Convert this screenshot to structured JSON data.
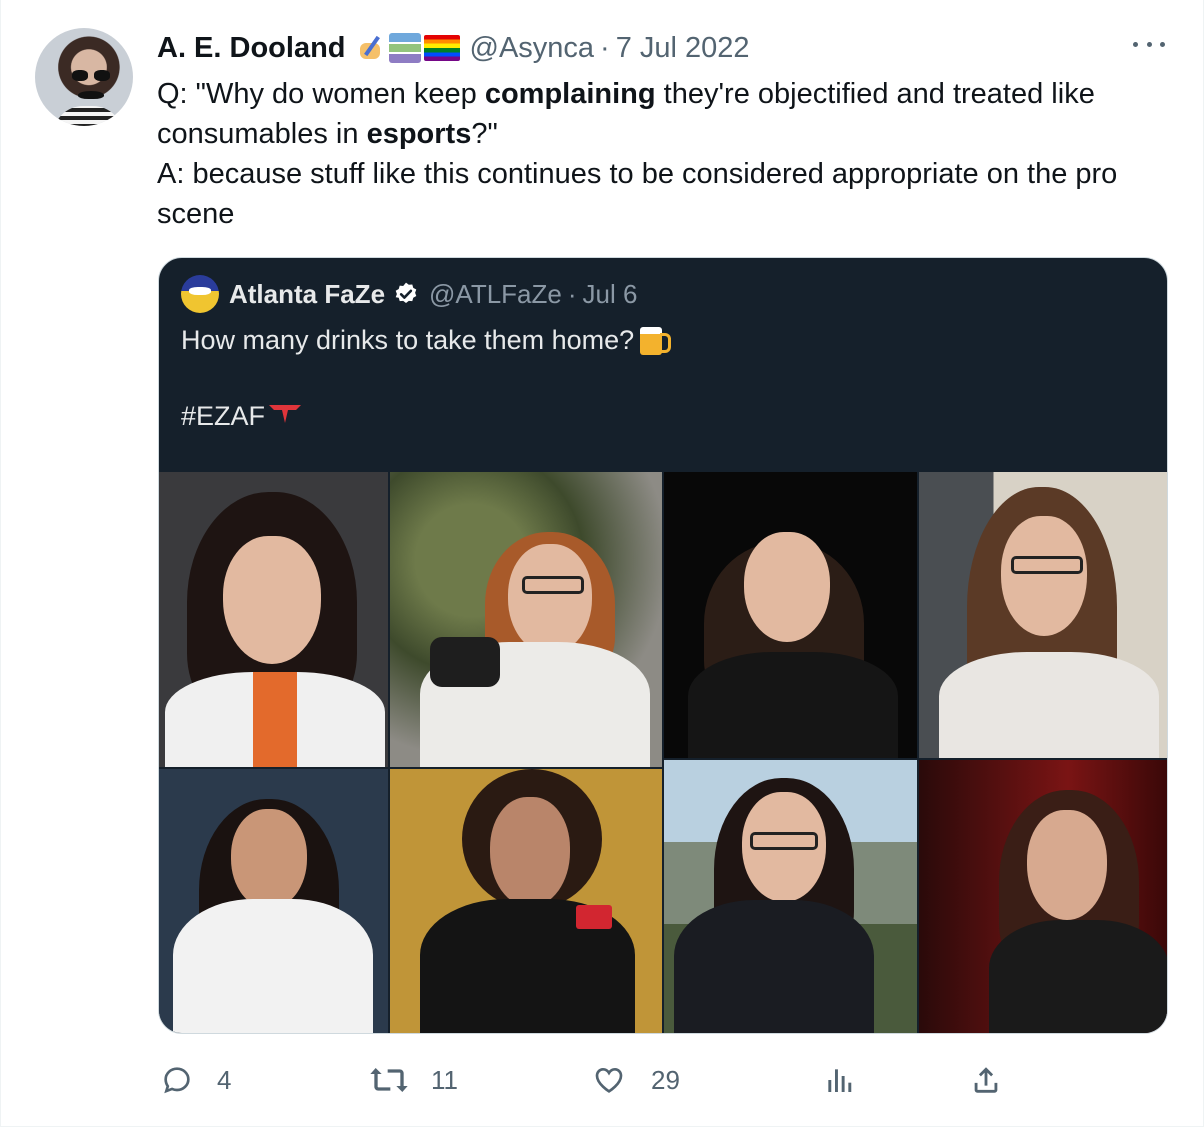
{
  "tweet": {
    "author_name": "A. E. Dooland",
    "author_handle": "@Asynca",
    "separator": "·",
    "date": "7 Jul 2022",
    "emoji_icons": [
      "writing-hand-icon",
      "books-icon",
      "rainbow-flag-icon"
    ],
    "text": {
      "line1_pre": "Q: \"Why do women keep ",
      "line1_bold": "complaining",
      "line1_post": " they're objectified and treated like consumables in ",
      "line1_bold2": "esports",
      "line1_end": "?\"",
      "line2": "A: because stuff like this continues to be considered appropriate on the pro scene"
    }
  },
  "quoted": {
    "author_name": "Atlanta FaZe",
    "verified": true,
    "author_handle": "@ATLFaZe",
    "separator": "·",
    "date": "Jul 6",
    "text_line1": "How many drinks to take them home?",
    "text_line2": "#EZAF",
    "photo_count": 8
  },
  "actions": {
    "replies": "4",
    "retweets": "11",
    "likes": "29",
    "icons": [
      "reply-icon",
      "retweet-icon",
      "like-icon",
      "views-icon",
      "share-icon"
    ]
  },
  "colors": {
    "text_primary": "#0f1419",
    "text_secondary": "#536471",
    "quote_bg": "#15202b",
    "quote_text": "#e7e9ea",
    "quote_secondary": "#8b98a5",
    "verified": "#ffffff"
  }
}
